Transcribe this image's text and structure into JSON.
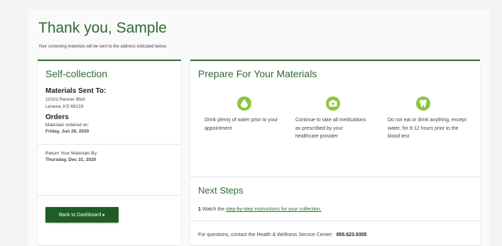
{
  "header": {
    "title": "Thank you, Sample",
    "subtitle": "Your screening materials will be sent to the address indicated below."
  },
  "left_card": {
    "title": "Self-collection",
    "materials_heading": "Materials Sent To:",
    "address_line1": "10101 Renner Blvd",
    "address_line2": "Lenexa, KS 66219",
    "orders_heading": "Orders",
    "ordered_on_label": "Materials ordered on:",
    "ordered_on_date": "Friday, Jun 26, 2020",
    "return_label": "Return Your Materials By:",
    "return_date": "Thursday, Dec 31, 2020",
    "back_button": "Back to Dashboard ▸"
  },
  "prepare": {
    "title": "Prepare For Your Materials",
    "items": [
      {
        "icon": "water-drop-icon",
        "text": "Drink plenty of water prior to your appointment"
      },
      {
        "icon": "medication-icon",
        "text": "Continue to take all medications as prescribed by your healthcare provider"
      },
      {
        "icon": "tooth-icon",
        "text": "Do not eat or drink anything, except water, for 9-12 hours prior to the blood test"
      }
    ]
  },
  "next_steps": {
    "title": "Next Steps",
    "step_number": "1",
    "step_prefix": "Watch the",
    "step_link": "step-by-step instructions for your collection.",
    "contact_text": "For questions, contact the Health & Wellness Service Center:",
    "contact_phone": "855.623.9355"
  },
  "colors": {
    "brand_green": "#2e6b30",
    "button_green": "#1e5e25",
    "icon_green": "#8dc63f"
  }
}
